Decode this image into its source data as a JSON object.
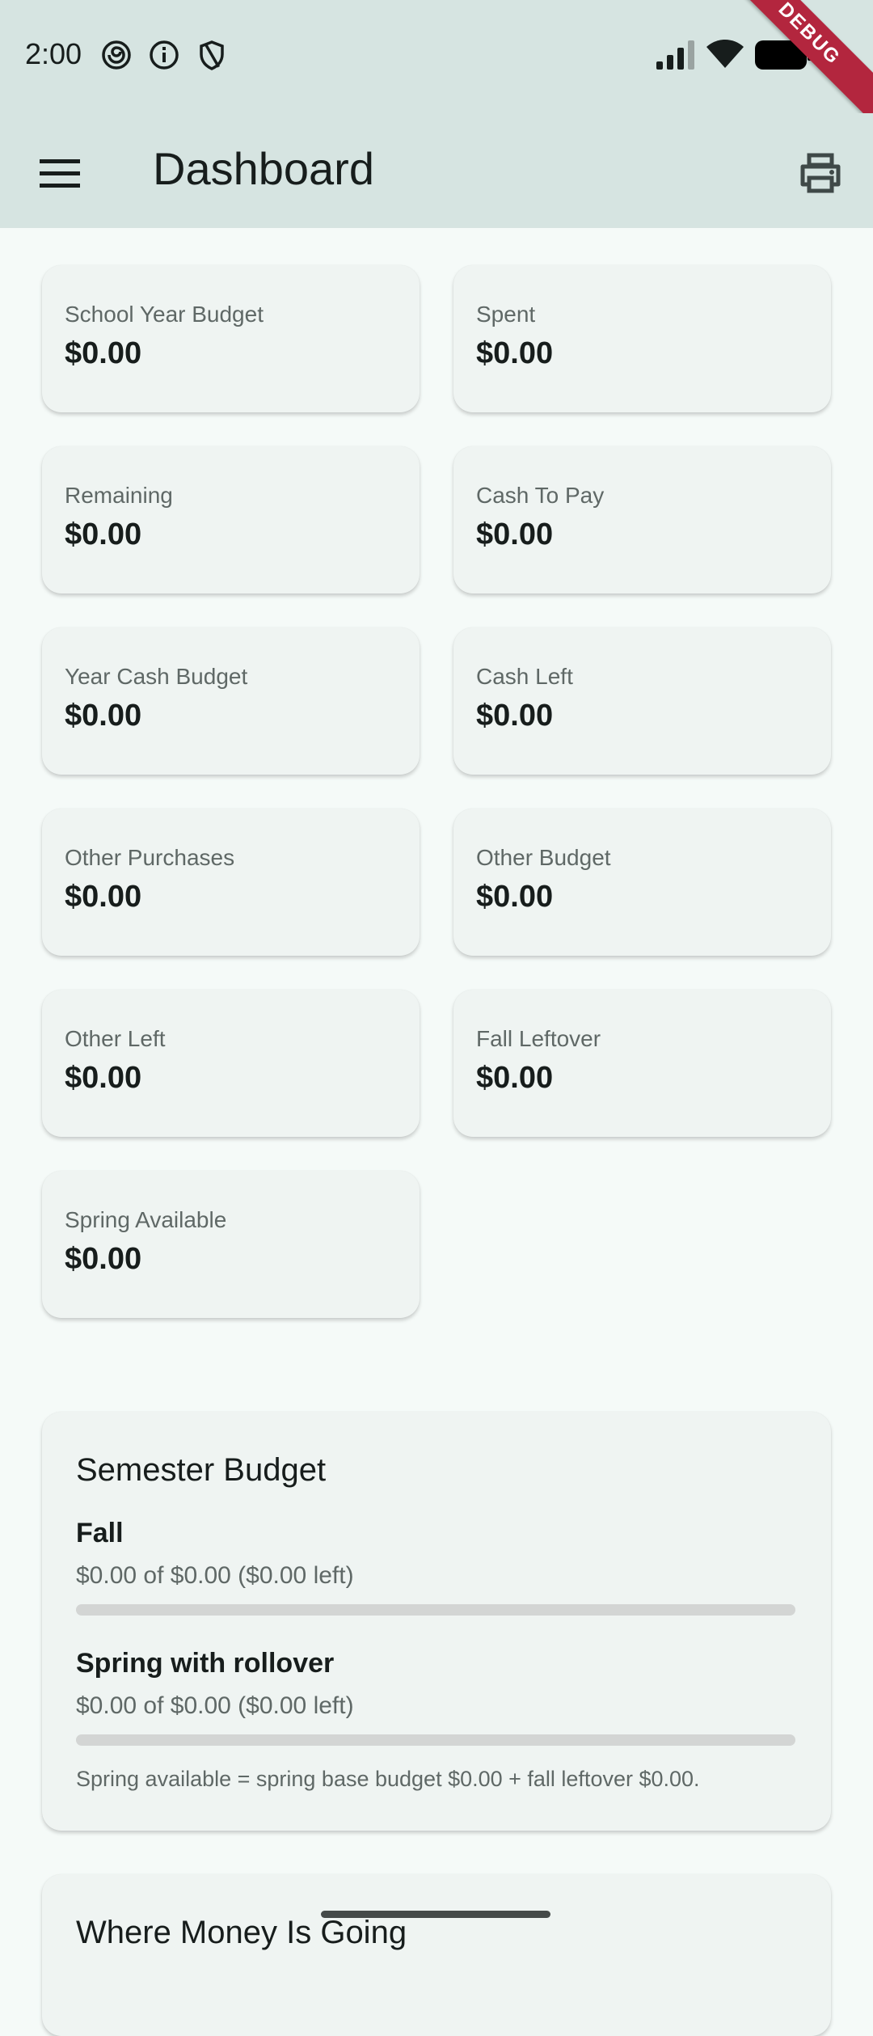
{
  "status_bar": {
    "time": "2:00",
    "left_icons": [
      "spiral-icon",
      "info-icon",
      "shield-icon"
    ],
    "right_icons": [
      "signal-icon",
      "wifi-icon",
      "battery-icon"
    ],
    "debug_label": "DEBUG"
  },
  "app_bar": {
    "title": "Dashboard",
    "menu_icon": "menu-icon",
    "action_icon": "print-icon"
  },
  "stats": [
    {
      "label": "School Year Budget",
      "value": "$0.00"
    },
    {
      "label": "Spent",
      "value": "$0.00"
    },
    {
      "label": "Remaining",
      "value": "$0.00"
    },
    {
      "label": "Cash To Pay",
      "value": "$0.00"
    },
    {
      "label": "Year Cash Budget",
      "value": "$0.00"
    },
    {
      "label": "Cash Left",
      "value": "$0.00"
    },
    {
      "label": "Other Purchases",
      "value": "$0.00"
    },
    {
      "label": "Other Budget",
      "value": "$0.00"
    },
    {
      "label": "Other Left",
      "value": "$0.00"
    },
    {
      "label": "Fall Leftover",
      "value": "$0.00"
    },
    {
      "label": "Spring Available",
      "value": "$0.00"
    }
  ],
  "semester_budget": {
    "title": "Semester Budget",
    "fall": {
      "name": "Fall",
      "detail": "$0.00 of $0.00 ($0.00 left)",
      "progress": 0
    },
    "spring": {
      "name": "Spring with rollover",
      "detail": "$0.00 of $0.00 ($0.00 left)",
      "progress": 0
    },
    "note": "Spring available = spring base budget $0.00 + fall leftover $0.00."
  },
  "where_money": {
    "title": "Where Money Is Going"
  },
  "colors": {
    "app_bar_bg": "#d6e4e1",
    "page_bg": "#f5faf8",
    "card_bg": "#eff4f2",
    "debug_ribbon": "#b3263e"
  }
}
